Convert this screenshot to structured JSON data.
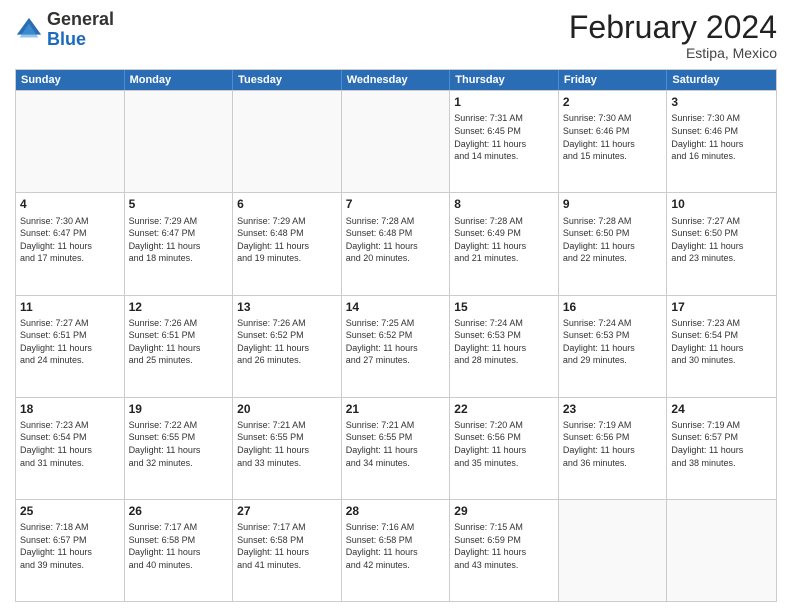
{
  "header": {
    "logo_general": "General",
    "logo_blue": "Blue",
    "title": "February 2024",
    "subtitle": "Estipa, Mexico"
  },
  "calendar": {
    "weekdays": [
      "Sunday",
      "Monday",
      "Tuesday",
      "Wednesday",
      "Thursday",
      "Friday",
      "Saturday"
    ],
    "rows": [
      [
        {
          "day": "",
          "empty": true
        },
        {
          "day": "",
          "empty": true
        },
        {
          "day": "",
          "empty": true
        },
        {
          "day": "",
          "empty": true
        },
        {
          "day": "1",
          "lines": [
            "Sunrise: 7:31 AM",
            "Sunset: 6:45 PM",
            "Daylight: 11 hours",
            "and 14 minutes."
          ]
        },
        {
          "day": "2",
          "lines": [
            "Sunrise: 7:30 AM",
            "Sunset: 6:46 PM",
            "Daylight: 11 hours",
            "and 15 minutes."
          ]
        },
        {
          "day": "3",
          "lines": [
            "Sunrise: 7:30 AM",
            "Sunset: 6:46 PM",
            "Daylight: 11 hours",
            "and 16 minutes."
          ]
        }
      ],
      [
        {
          "day": "4",
          "lines": [
            "Sunrise: 7:30 AM",
            "Sunset: 6:47 PM",
            "Daylight: 11 hours",
            "and 17 minutes."
          ]
        },
        {
          "day": "5",
          "lines": [
            "Sunrise: 7:29 AM",
            "Sunset: 6:47 PM",
            "Daylight: 11 hours",
            "and 18 minutes."
          ]
        },
        {
          "day": "6",
          "lines": [
            "Sunrise: 7:29 AM",
            "Sunset: 6:48 PM",
            "Daylight: 11 hours",
            "and 19 minutes."
          ]
        },
        {
          "day": "7",
          "lines": [
            "Sunrise: 7:28 AM",
            "Sunset: 6:48 PM",
            "Daylight: 11 hours",
            "and 20 minutes."
          ]
        },
        {
          "day": "8",
          "lines": [
            "Sunrise: 7:28 AM",
            "Sunset: 6:49 PM",
            "Daylight: 11 hours",
            "and 21 minutes."
          ]
        },
        {
          "day": "9",
          "lines": [
            "Sunrise: 7:28 AM",
            "Sunset: 6:50 PM",
            "Daylight: 11 hours",
            "and 22 minutes."
          ]
        },
        {
          "day": "10",
          "lines": [
            "Sunrise: 7:27 AM",
            "Sunset: 6:50 PM",
            "Daylight: 11 hours",
            "and 23 minutes."
          ]
        }
      ],
      [
        {
          "day": "11",
          "lines": [
            "Sunrise: 7:27 AM",
            "Sunset: 6:51 PM",
            "Daylight: 11 hours",
            "and 24 minutes."
          ]
        },
        {
          "day": "12",
          "lines": [
            "Sunrise: 7:26 AM",
            "Sunset: 6:51 PM",
            "Daylight: 11 hours",
            "and 25 minutes."
          ]
        },
        {
          "day": "13",
          "lines": [
            "Sunrise: 7:26 AM",
            "Sunset: 6:52 PM",
            "Daylight: 11 hours",
            "and 26 minutes."
          ]
        },
        {
          "day": "14",
          "lines": [
            "Sunrise: 7:25 AM",
            "Sunset: 6:52 PM",
            "Daylight: 11 hours",
            "and 27 minutes."
          ]
        },
        {
          "day": "15",
          "lines": [
            "Sunrise: 7:24 AM",
            "Sunset: 6:53 PM",
            "Daylight: 11 hours",
            "and 28 minutes."
          ]
        },
        {
          "day": "16",
          "lines": [
            "Sunrise: 7:24 AM",
            "Sunset: 6:53 PM",
            "Daylight: 11 hours",
            "and 29 minutes."
          ]
        },
        {
          "day": "17",
          "lines": [
            "Sunrise: 7:23 AM",
            "Sunset: 6:54 PM",
            "Daylight: 11 hours",
            "and 30 minutes."
          ]
        }
      ],
      [
        {
          "day": "18",
          "lines": [
            "Sunrise: 7:23 AM",
            "Sunset: 6:54 PM",
            "Daylight: 11 hours",
            "and 31 minutes."
          ]
        },
        {
          "day": "19",
          "lines": [
            "Sunrise: 7:22 AM",
            "Sunset: 6:55 PM",
            "Daylight: 11 hours",
            "and 32 minutes."
          ]
        },
        {
          "day": "20",
          "lines": [
            "Sunrise: 7:21 AM",
            "Sunset: 6:55 PM",
            "Daylight: 11 hours",
            "and 33 minutes."
          ]
        },
        {
          "day": "21",
          "lines": [
            "Sunrise: 7:21 AM",
            "Sunset: 6:55 PM",
            "Daylight: 11 hours",
            "and 34 minutes."
          ]
        },
        {
          "day": "22",
          "lines": [
            "Sunrise: 7:20 AM",
            "Sunset: 6:56 PM",
            "Daylight: 11 hours",
            "and 35 minutes."
          ]
        },
        {
          "day": "23",
          "lines": [
            "Sunrise: 7:19 AM",
            "Sunset: 6:56 PM",
            "Daylight: 11 hours",
            "and 36 minutes."
          ]
        },
        {
          "day": "24",
          "lines": [
            "Sunrise: 7:19 AM",
            "Sunset: 6:57 PM",
            "Daylight: 11 hours",
            "and 38 minutes."
          ]
        }
      ],
      [
        {
          "day": "25",
          "lines": [
            "Sunrise: 7:18 AM",
            "Sunset: 6:57 PM",
            "Daylight: 11 hours",
            "and 39 minutes."
          ]
        },
        {
          "day": "26",
          "lines": [
            "Sunrise: 7:17 AM",
            "Sunset: 6:58 PM",
            "Daylight: 11 hours",
            "and 40 minutes."
          ]
        },
        {
          "day": "27",
          "lines": [
            "Sunrise: 7:17 AM",
            "Sunset: 6:58 PM",
            "Daylight: 11 hours",
            "and 41 minutes."
          ]
        },
        {
          "day": "28",
          "lines": [
            "Sunrise: 7:16 AM",
            "Sunset: 6:58 PM",
            "Daylight: 11 hours",
            "and 42 minutes."
          ]
        },
        {
          "day": "29",
          "lines": [
            "Sunrise: 7:15 AM",
            "Sunset: 6:59 PM",
            "Daylight: 11 hours",
            "and 43 minutes."
          ]
        },
        {
          "day": "",
          "empty": true
        },
        {
          "day": "",
          "empty": true
        }
      ]
    ]
  }
}
